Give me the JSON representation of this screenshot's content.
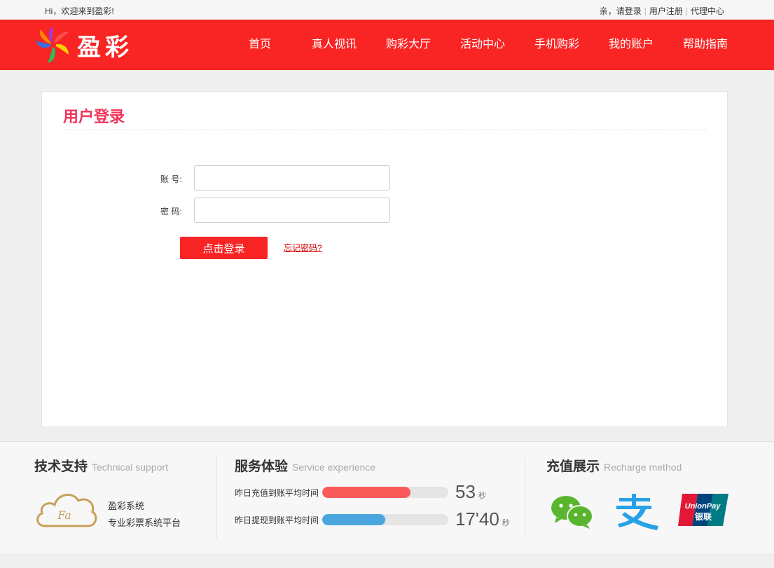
{
  "topbar": {
    "welcome": "Hi，欢迎来到盈彩!",
    "login_prompt": "亲，请登录",
    "register": "用户注册",
    "agent": "代理中心"
  },
  "header": {
    "logo_text": "盈彩",
    "nav": [
      "首页",
      "真人视讯",
      "购彩大厅",
      "活动中心",
      "手机购彩",
      "我的账户",
      "帮助指南"
    ]
  },
  "login": {
    "title": "用户登录",
    "account_label": "账 号:",
    "password_label": "密 码:",
    "account_value": "",
    "password_value": "",
    "submit": "点击登录",
    "forgot": "忘记密码?"
  },
  "footer": {
    "support": {
      "title": "技术支持",
      "title_en": "Technical support",
      "cloud_text": "Fa",
      "line1": "盈彩系统",
      "line2": "专业彩票系统平台"
    },
    "service": {
      "title": "服务体验",
      "title_en": "Service experience",
      "stats": [
        {
          "label": "昨日充值到账平均时间",
          "value": "53",
          "unit": "秒",
          "fill": 0.7,
          "color": "#fa5a5a"
        },
        {
          "label": "昨日提现到账平均时间",
          "value": "17'40",
          "unit": "秒",
          "fill": 0.5,
          "color": "#4aa6dc"
        }
      ]
    },
    "recharge": {
      "title": "充值展示",
      "title_en": "Recharge method",
      "methods": [
        "wechat-icon",
        "alipay-icon",
        "unionpay-icon"
      ],
      "unionpay_text": "UnionPay",
      "unionpay_cn": "银联"
    }
  }
}
